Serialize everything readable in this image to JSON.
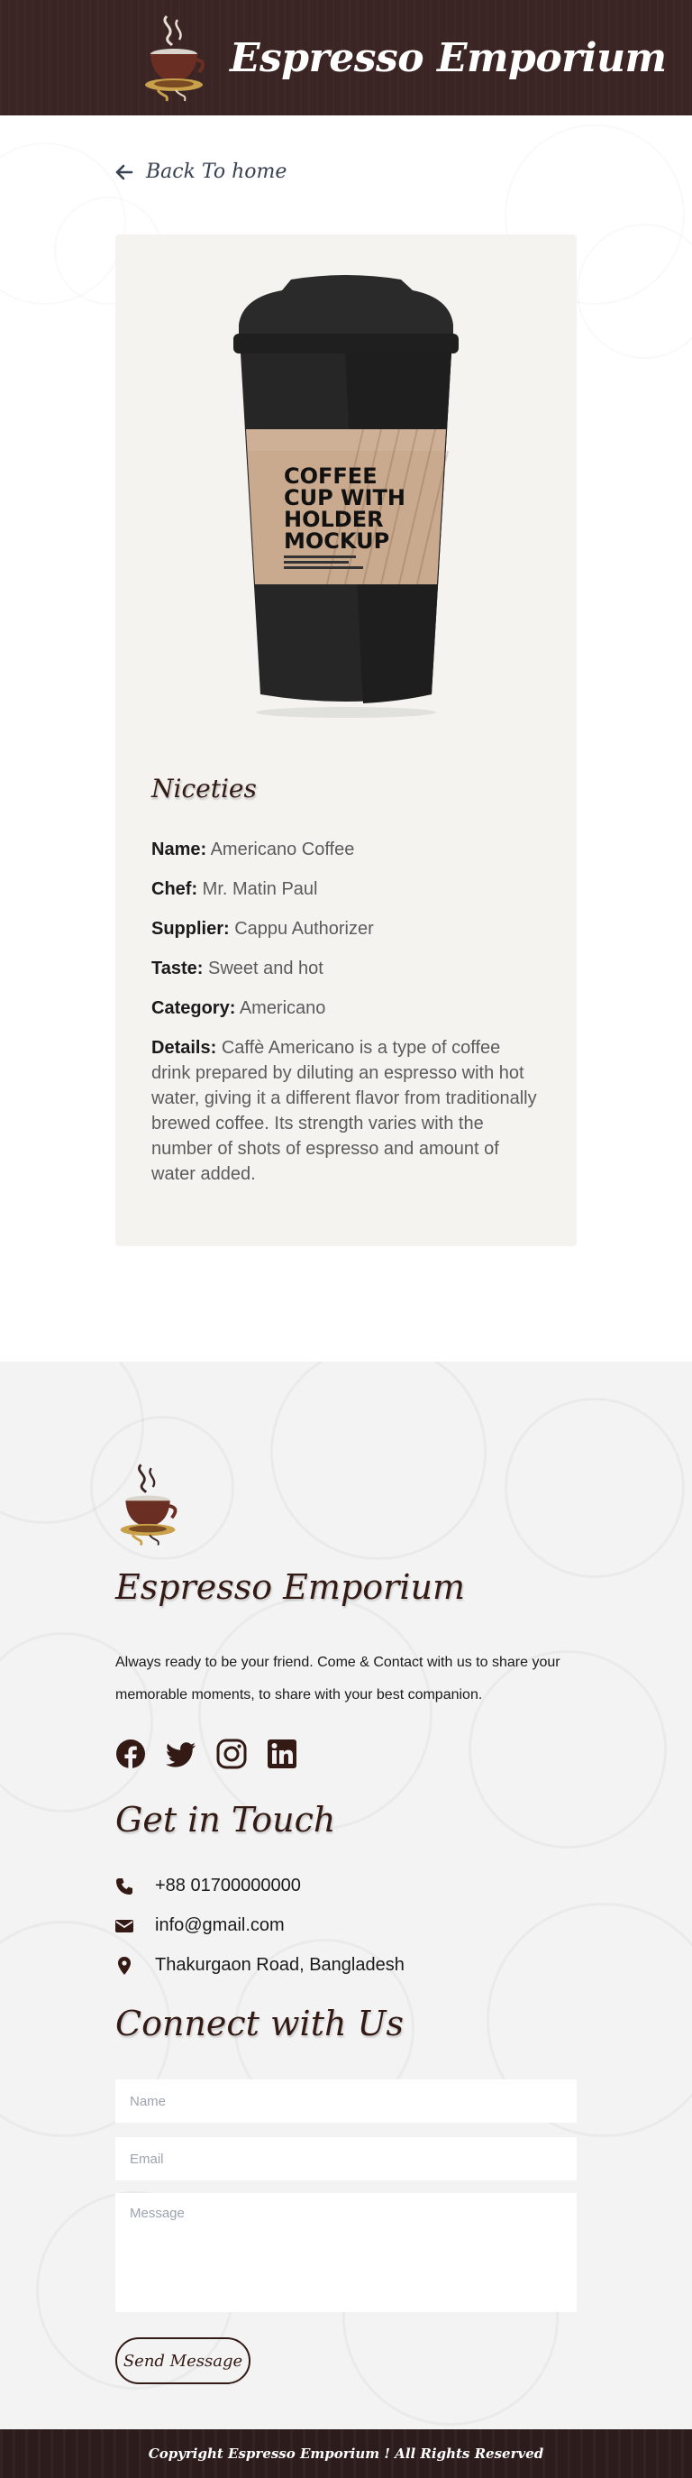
{
  "header": {
    "title": "Espresso Emporium",
    "logo_icon": "coffee-cup-logo"
  },
  "nav": {
    "back_label": "Back To home",
    "back_icon": "arrow-left-icon"
  },
  "product": {
    "image": "coffee-cup-holder-mockup",
    "section_title": "Niceties",
    "details": [
      {
        "label": "Name:",
        "value": "Americano Coffee"
      },
      {
        "label": "Chef:",
        "value": "Mr. Matin Paul"
      },
      {
        "label": "Supplier:",
        "value": "Cappu Authorizer"
      },
      {
        "label": "Taste:",
        "value": "Sweet and hot"
      },
      {
        "label": "Category:",
        "value": "Americano"
      },
      {
        "label": "Details:",
        "value": "Caffè Americano is a type of coffee drink prepared by diluting an espresso with hot water, giving it a different flavor from traditionally brewed coffee. Its strength varies with the number of shots of espresso and amount of water added."
      }
    ],
    "mockup_text": [
      "COFFEE",
      "CUP WITH",
      "HOLDER",
      "MOCKUP"
    ]
  },
  "footer": {
    "title": "Espresso Emporium",
    "description": "Always ready to be your friend. Come & Contact with us to share your memorable moments, to share with your best companion.",
    "socials": [
      "facebook-icon",
      "twitter-icon",
      "instagram-icon",
      "linkedin-icon"
    ],
    "contact_title": "Get in Touch",
    "contacts": [
      {
        "icon": "phone-icon",
        "text": "+88 01700000000"
      },
      {
        "icon": "envelope-icon",
        "text": "info@gmail.com"
      },
      {
        "icon": "location-pin-icon",
        "text": "Thakurgaon Road, Bangladesh"
      }
    ],
    "form_title": "Connect with Us",
    "form": {
      "name_placeholder": "Name",
      "email_placeholder": "Email",
      "message_placeholder": "Message",
      "submit_label": "Send Message"
    },
    "copyright": "Copyright Espresso Emporium ! All Rights Reserved"
  },
  "colors": {
    "header_bg": "#3b2524",
    "accent": "#331a15",
    "card_bg": "#f4f3f0",
    "footer_bg": "#f3f3f3"
  }
}
